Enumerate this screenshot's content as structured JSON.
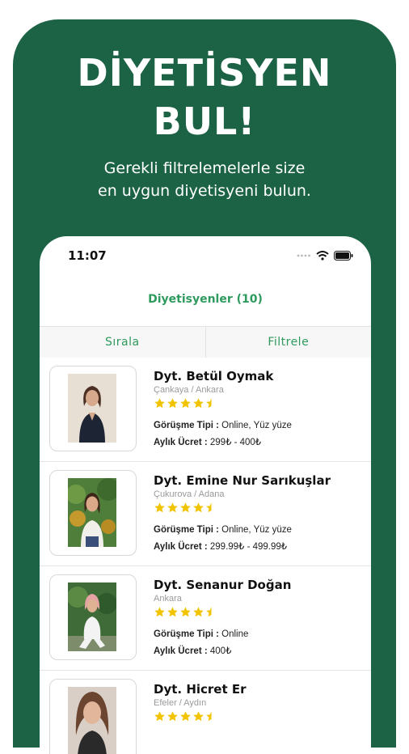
{
  "promo": {
    "headline_line1": "DİYETİSYEN",
    "headline_line2": "BUL!",
    "subhead_line1": "Gerekli filtrelemelerle size",
    "subhead_line2": "en uygun diyetisyeni bulun.",
    "accent_color": "#1c6346"
  },
  "status_bar": {
    "time": "11:07",
    "icons": [
      "signal-dots-icon",
      "wifi-icon",
      "battery-icon"
    ]
  },
  "nav": {
    "title": "Diyetisyenler (10)"
  },
  "toolbar": {
    "sort_label": "Sırala",
    "filter_label": "Filtrele"
  },
  "dietitians": [
    {
      "name": "Dyt. Betül Oymak",
      "location": "Çankaya / Ankara",
      "rating": 4.5,
      "meeting_label": "Görüşme Tipi :",
      "meeting_value": " Online, Yüz yüze",
      "fee_label": "Aylık Ücret :",
      "fee_value": " 299₺ - 400₺"
    },
    {
      "name": "Dyt. Emine Nur Sarıkuşlar",
      "location": "Çukurova / Adana",
      "rating": 4.5,
      "meeting_label": "Görüşme Tipi :",
      "meeting_value": " Online, Yüz yüze",
      "fee_label": "Aylık Ücret :",
      "fee_value": " 299.99₺ - 499.99₺"
    },
    {
      "name": "Dyt. Senanur Doğan",
      "location": "Ankara",
      "rating": 4.5,
      "meeting_label": "Görüşme Tipi :",
      "meeting_value": " Online",
      "fee_label": "Aylık Ücret :",
      "fee_value": " 400₺"
    },
    {
      "name": "Dyt. Hicret Er",
      "location": "Efeler / Aydın",
      "rating": 4.5
    }
  ],
  "colors": {
    "green_text": "#2e9a5e",
    "star": "#f2c400"
  }
}
